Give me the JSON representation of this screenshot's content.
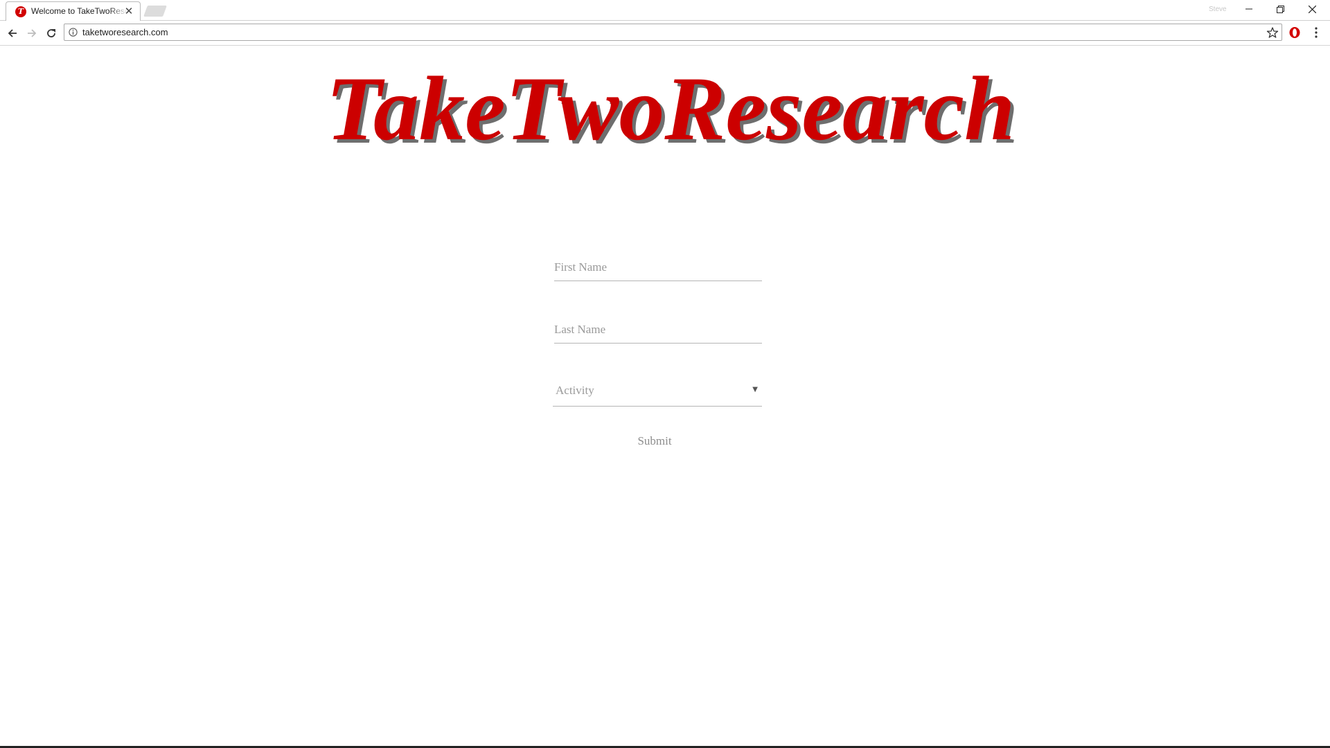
{
  "browser": {
    "tab_title": "Welcome to TakeTwoResearch",
    "favicon_letter": "T",
    "profile_label": "Steve",
    "url": "taketworesearch.com"
  },
  "page": {
    "logo_text": "TakeTwoResearch",
    "brand_color": "#cc0000",
    "form": {
      "first_name_placeholder": "First Name",
      "last_name_placeholder": "Last Name",
      "activity_value": "Activity",
      "submit_label": "Submit"
    }
  }
}
